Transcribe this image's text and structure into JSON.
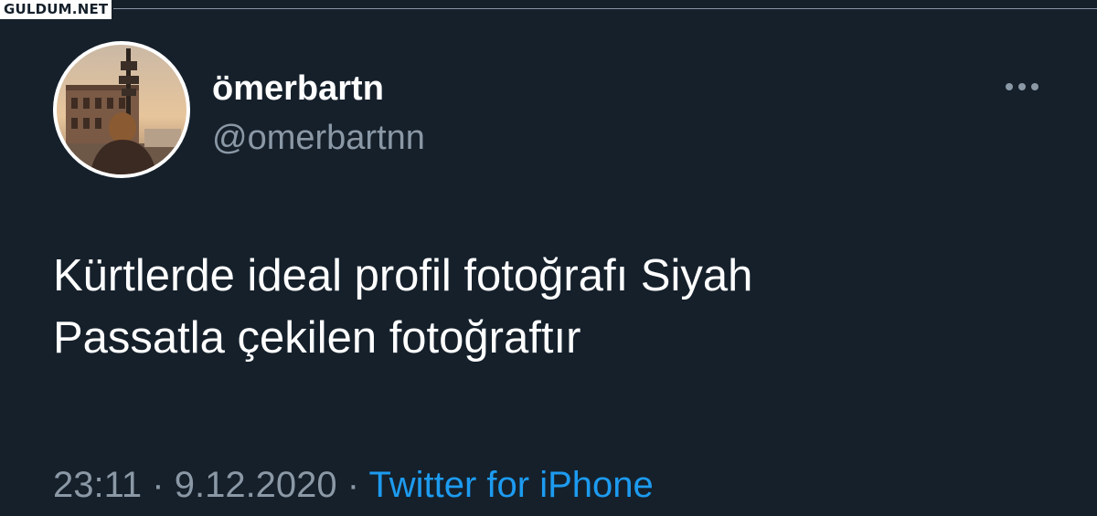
{
  "watermark": "GULDUM.NET",
  "user": {
    "display_name": "ömerbartn",
    "handle": "@omerbartnn"
  },
  "more_icon": "more-horizontal-icon",
  "tweet": {
    "line1": "Kürtlerde ideal profil fotoğrafı Siyah",
    "line2": "Passatla çekilen fotoğraftır",
    "time": "23:11",
    "separator": "·",
    "date": "9.12.2020",
    "source": "Twitter for iPhone"
  },
  "colors": {
    "background": "#15202b",
    "text": "#ffffff",
    "secondary": "#8b98a5",
    "link": "#1d9bf0"
  }
}
